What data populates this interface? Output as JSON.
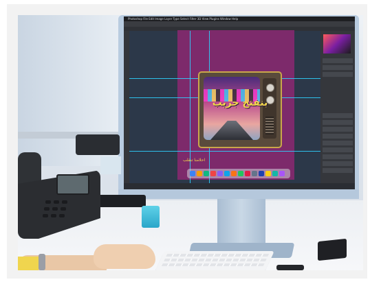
{
  "photo": {
    "description_colors": {
      "artboard": "#7d2a6b",
      "title_text": "#f2d64b",
      "guides": "#2fd1ff",
      "monitor": "#b9cce0"
    }
  },
  "screen": {
    "app_menu": "Photoshop  File  Edit  Image  Layer  Type  Select  Filter  3D  View  Plugins  Window  Help",
    "document_tab": "",
    "artwork": {
      "title_text": "بنفتح جريب",
      "caption_text": "احلامنا تنقلب"
    }
  }
}
